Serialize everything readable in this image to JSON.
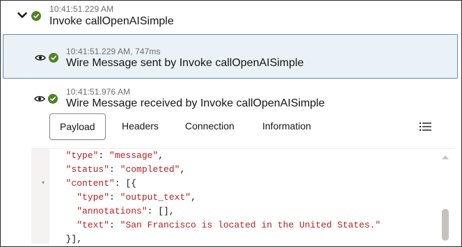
{
  "steps": [
    {
      "time": "10:41:51.229 AM",
      "title": "Invoke callOpenAISimple",
      "status": "success"
    },
    {
      "time": "10:41:51.229 AM, 747ms",
      "title": "Wire Message sent by Invoke callOpenAISimple",
      "status": "success",
      "selected": true
    },
    {
      "time": "10:41:51.976 AM",
      "title": "Wire Message received by Invoke callOpenAISimple",
      "status": "success"
    }
  ],
  "tabs": {
    "payload": "Payload",
    "headers": "Headers",
    "connection": "Connection",
    "information": "Information",
    "active": "Payload"
  },
  "code": {
    "lines": [
      {
        "indent": "  ",
        "key": "\"type\"",
        "sep": ": ",
        "value": "\"message\"",
        "end": ","
      },
      {
        "indent": "  ",
        "key": "\"status\"",
        "sep": ": ",
        "value": "\"completed\"",
        "end": ","
      },
      {
        "indent": "  ",
        "key": "\"content\"",
        "sep": ": ",
        "value": "",
        "end": "[{"
      },
      {
        "indent": "    ",
        "key": "\"type\"",
        "sep": ": ",
        "value": "\"output_text\"",
        "end": ","
      },
      {
        "indent": "    ",
        "key": "\"annotations\"",
        "sep": ": ",
        "value": "",
        "end": "[],"
      },
      {
        "indent": "    ",
        "key": "\"text\"",
        "sep": ": ",
        "value": "\"San Francisco is located in the United States.\"",
        "end": ""
      },
      {
        "indent": "  ",
        "key": "",
        "sep": "",
        "value": "",
        "end": "}],"
      }
    ]
  },
  "colors": {
    "success": "#508223",
    "selected_bg": "#eaf2f8",
    "selected_border": "#5e8fb0",
    "json_string": "#b42020"
  },
  "icons": {
    "expand": "chevron-down-icon",
    "view": "eye-icon",
    "success": "check-circle-icon",
    "list": "list-icon"
  }
}
